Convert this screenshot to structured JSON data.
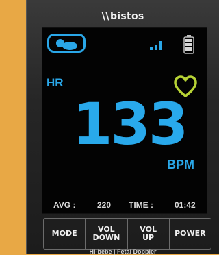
{
  "device": {
    "brand": "bistos",
    "brand_mark": "\\\\",
    "footer": "Hi-bebe | Fetal Doppler"
  },
  "screen": {
    "hr_label": "HR",
    "hr_value": "133",
    "unit": "BPM",
    "avg_label": "AVG :",
    "avg_value": "220",
    "time_label": "TIME :",
    "time_value": "01:42"
  },
  "buttons": [
    {
      "label": "MODE"
    },
    {
      "label": "VOL\nDOWN"
    },
    {
      "label": "VOL\nUP"
    },
    {
      "label": "POWER"
    }
  ],
  "colors": {
    "accent_blue": "#29a9eb",
    "heart_green": "#b7d335",
    "background": "#e8a845"
  },
  "icons": [
    "baby-icon",
    "signal-icon",
    "battery-icon",
    "heart-icon"
  ]
}
